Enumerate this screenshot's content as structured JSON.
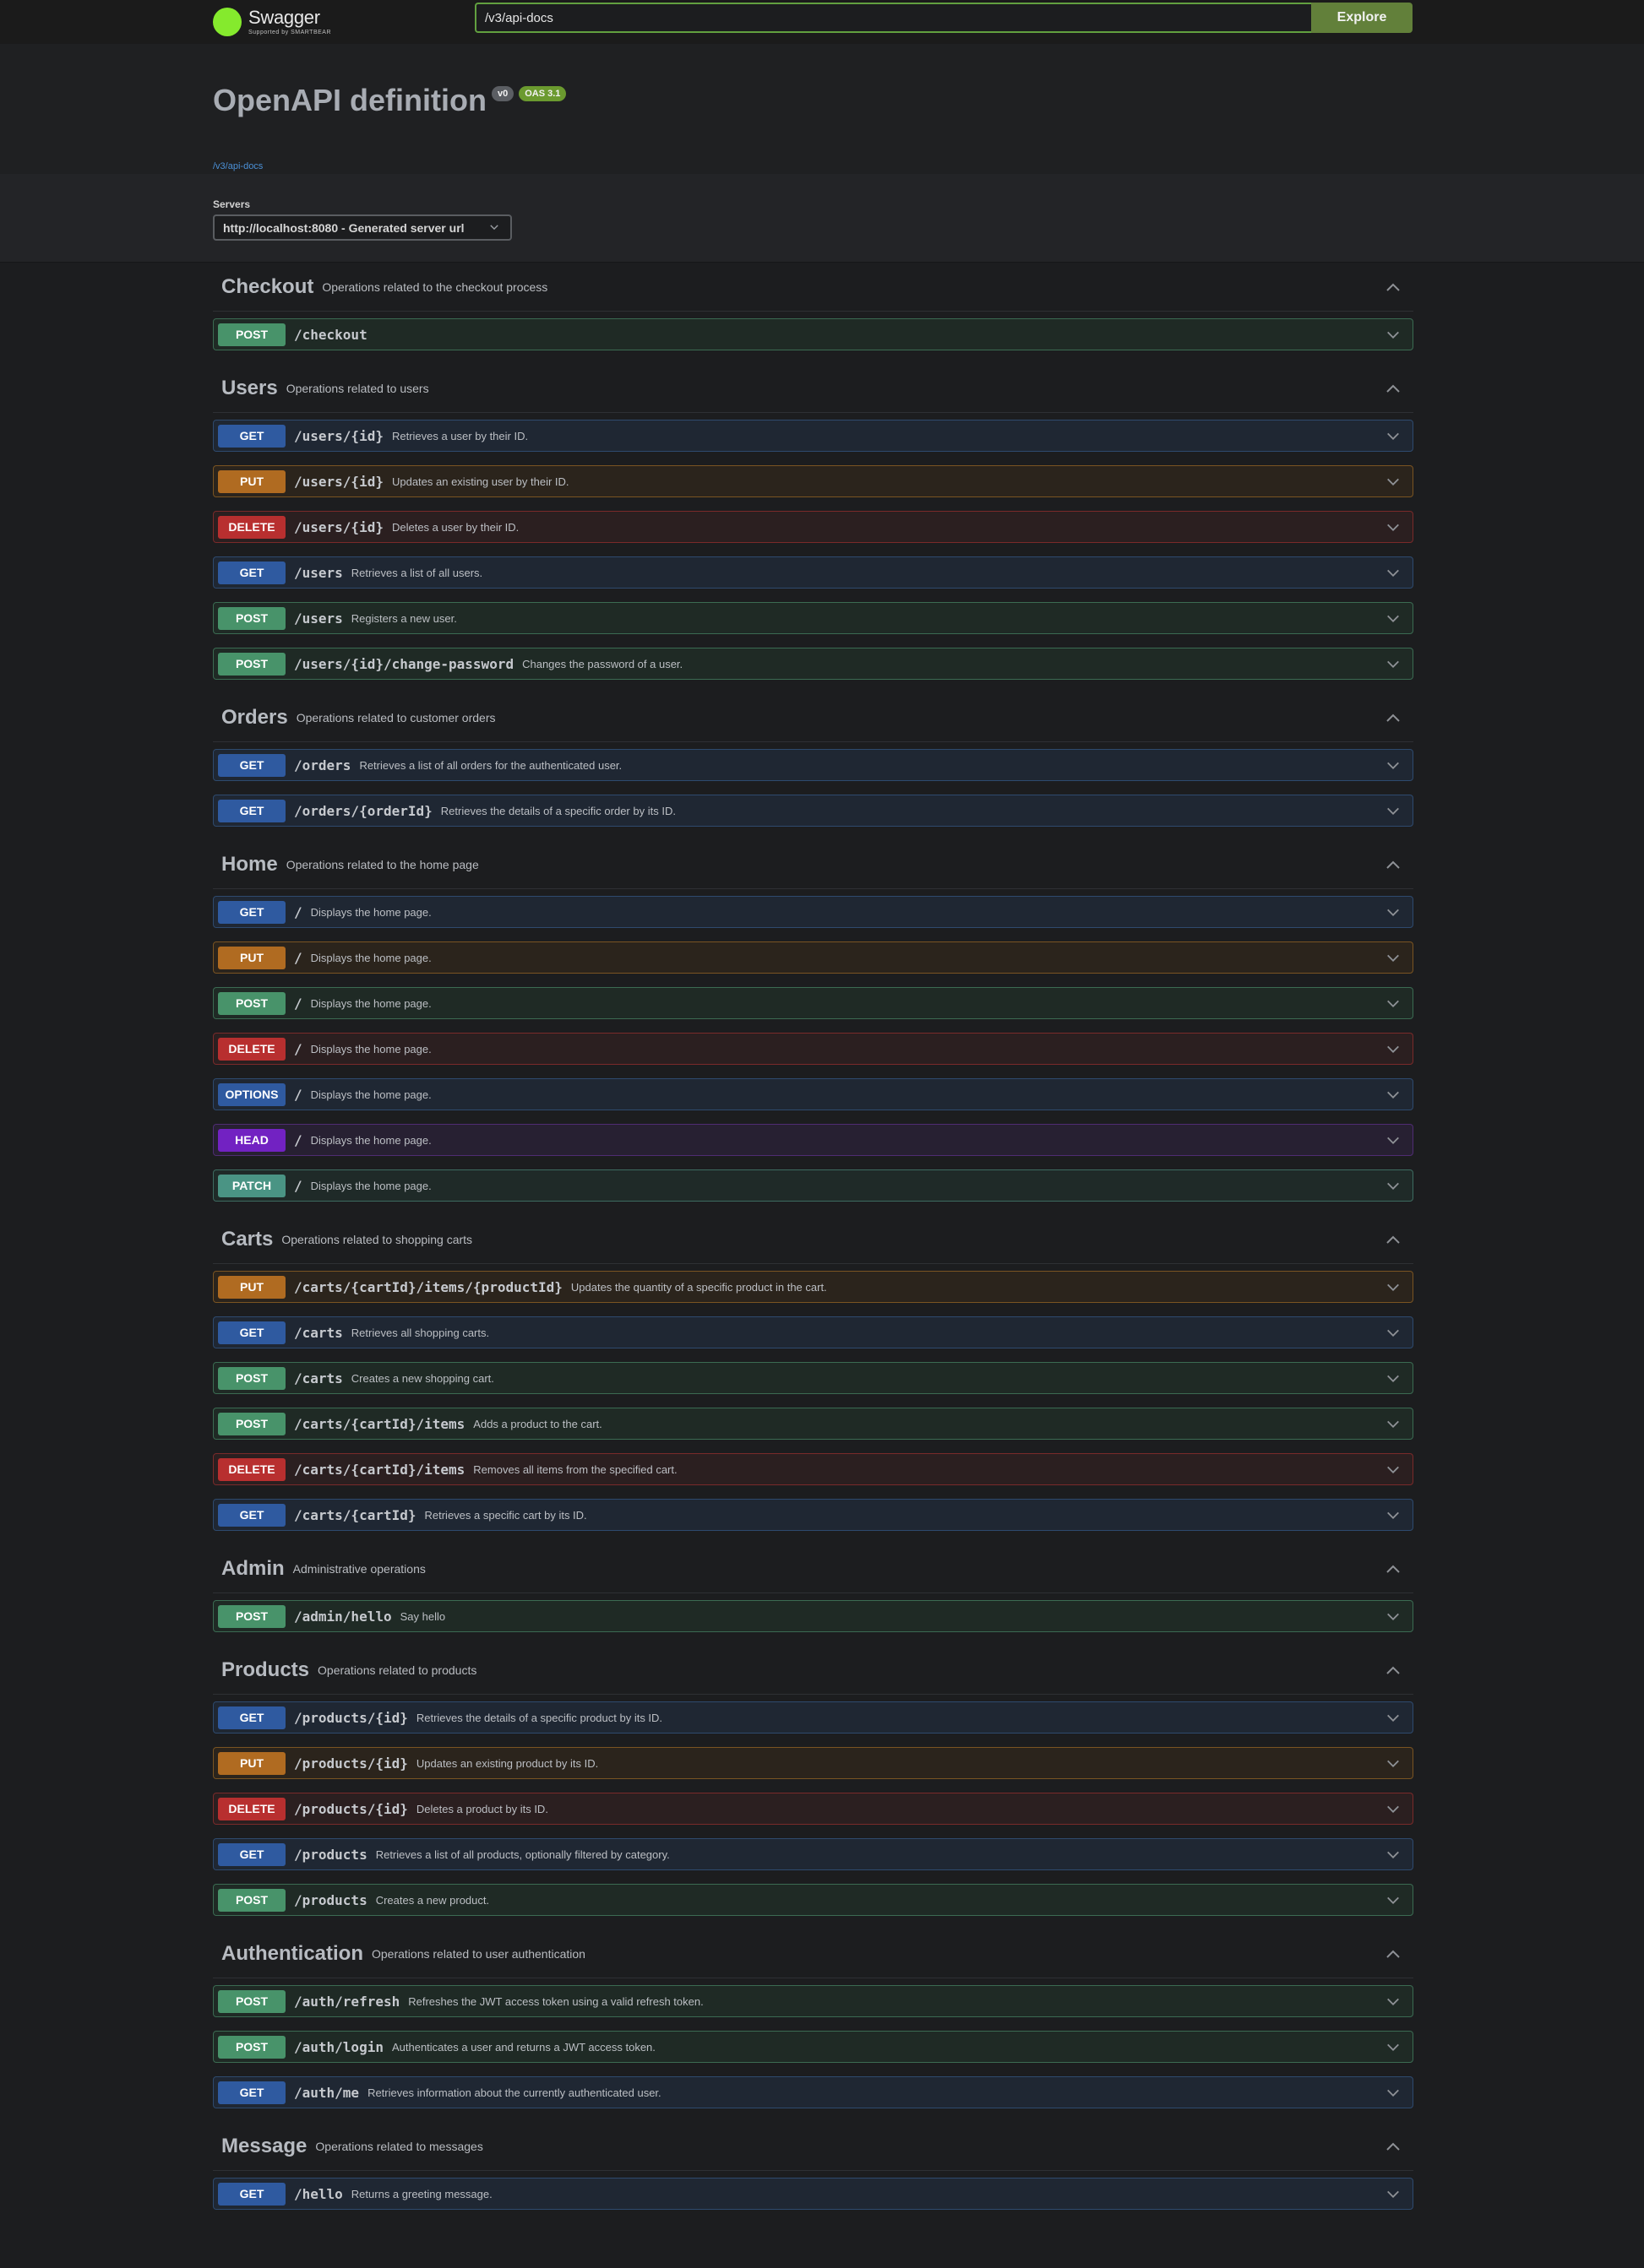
{
  "topbar": {
    "logo_name": "Swagger",
    "logo_sub": "Supported by SMARTBEAR",
    "url_value": "/v3/api-docs",
    "explore_label": "Explore"
  },
  "info": {
    "title": "OpenAPI definition",
    "version_badge": "v0",
    "oas_badge": "OAS 3.1",
    "spec_link": "/v3/api-docs"
  },
  "servers": {
    "label": "Servers",
    "selected": "http://localhost:8080 - Generated server url"
  },
  "method_colors": {
    "GET": "#2f5aa0",
    "POST": "#48936a",
    "PUT": "#b06b21",
    "DELETE": "#b82f2f",
    "OPTIONS": "#2f5aa0",
    "HEAD": "#7222c2",
    "PATCH": "#4a9484"
  },
  "tags": [
    {
      "name": "Checkout",
      "description": "Operations related to the checkout process",
      "operations": [
        {
          "method": "POST",
          "path": "/checkout",
          "summary": ""
        }
      ]
    },
    {
      "name": "Users",
      "description": "Operations related to users",
      "operations": [
        {
          "method": "GET",
          "path": "/users/{id}",
          "summary": "Retrieves a user by their ID."
        },
        {
          "method": "PUT",
          "path": "/users/{id}",
          "summary": "Updates an existing user by their ID."
        },
        {
          "method": "DELETE",
          "path": "/users/{id}",
          "summary": "Deletes a user by their ID."
        },
        {
          "method": "GET",
          "path": "/users",
          "summary": "Retrieves a list of all users."
        },
        {
          "method": "POST",
          "path": "/users",
          "summary": "Registers a new user."
        },
        {
          "method": "POST",
          "path": "/users/{id}/change-password",
          "summary": "Changes the password of a user."
        }
      ]
    },
    {
      "name": "Orders",
      "description": "Operations related to customer orders",
      "operations": [
        {
          "method": "GET",
          "path": "/orders",
          "summary": "Retrieves a list of all orders for the authenticated user."
        },
        {
          "method": "GET",
          "path": "/orders/{orderId}",
          "summary": "Retrieves the details of a specific order by its ID."
        }
      ]
    },
    {
      "name": "Home",
      "description": "Operations related to the home page",
      "operations": [
        {
          "method": "GET",
          "path": "/",
          "summary": "Displays the home page."
        },
        {
          "method": "PUT",
          "path": "/",
          "summary": "Displays the home page."
        },
        {
          "method": "POST",
          "path": "/",
          "summary": "Displays the home page."
        },
        {
          "method": "DELETE",
          "path": "/",
          "summary": "Displays the home page."
        },
        {
          "method": "OPTIONS",
          "path": "/",
          "summary": "Displays the home page."
        },
        {
          "method": "HEAD",
          "path": "/",
          "summary": "Displays the home page."
        },
        {
          "method": "PATCH",
          "path": "/",
          "summary": "Displays the home page."
        }
      ]
    },
    {
      "name": "Carts",
      "description": "Operations related to shopping carts",
      "operations": [
        {
          "method": "PUT",
          "path": "/carts/{cartId}/items/{productId}",
          "summary": "Updates the quantity of a specific product in the cart."
        },
        {
          "method": "GET",
          "path": "/carts",
          "summary": "Retrieves all shopping carts."
        },
        {
          "method": "POST",
          "path": "/carts",
          "summary": "Creates a new shopping cart."
        },
        {
          "method": "POST",
          "path": "/carts/{cartId}/items",
          "summary": "Adds a product to the cart."
        },
        {
          "method": "DELETE",
          "path": "/carts/{cartId}/items",
          "summary": "Removes all items from the specified cart."
        },
        {
          "method": "GET",
          "path": "/carts/{cartId}",
          "summary": "Retrieves a specific cart by its ID."
        }
      ]
    },
    {
      "name": "Admin",
      "description": "Administrative operations",
      "operations": [
        {
          "method": "POST",
          "path": "/admin/hello",
          "summary": "Say hello"
        }
      ]
    },
    {
      "name": "Products",
      "description": "Operations related to products",
      "operations": [
        {
          "method": "GET",
          "path": "/products/{id}",
          "summary": "Retrieves the details of a specific product by its ID."
        },
        {
          "method": "PUT",
          "path": "/products/{id}",
          "summary": "Updates an existing product by its ID."
        },
        {
          "method": "DELETE",
          "path": "/products/{id}",
          "summary": "Deletes a product by its ID."
        },
        {
          "method": "GET",
          "path": "/products",
          "summary": "Retrieves a list of all products, optionally filtered by category."
        },
        {
          "method": "POST",
          "path": "/products",
          "summary": "Creates a new product."
        }
      ]
    },
    {
      "name": "Authentication",
      "description": "Operations related to user authentication",
      "operations": [
        {
          "method": "POST",
          "path": "/auth/refresh",
          "summary": "Refreshes the JWT access token using a valid refresh token."
        },
        {
          "method": "POST",
          "path": "/auth/login",
          "summary": "Authenticates a user and returns a JWT access token."
        },
        {
          "method": "GET",
          "path": "/auth/me",
          "summary": "Retrieves information about the currently authenticated user."
        }
      ]
    },
    {
      "name": "Message",
      "description": "Operations related to messages",
      "operations": [
        {
          "method": "GET",
          "path": "/hello",
          "summary": "Returns a greeting message."
        }
      ]
    }
  ]
}
